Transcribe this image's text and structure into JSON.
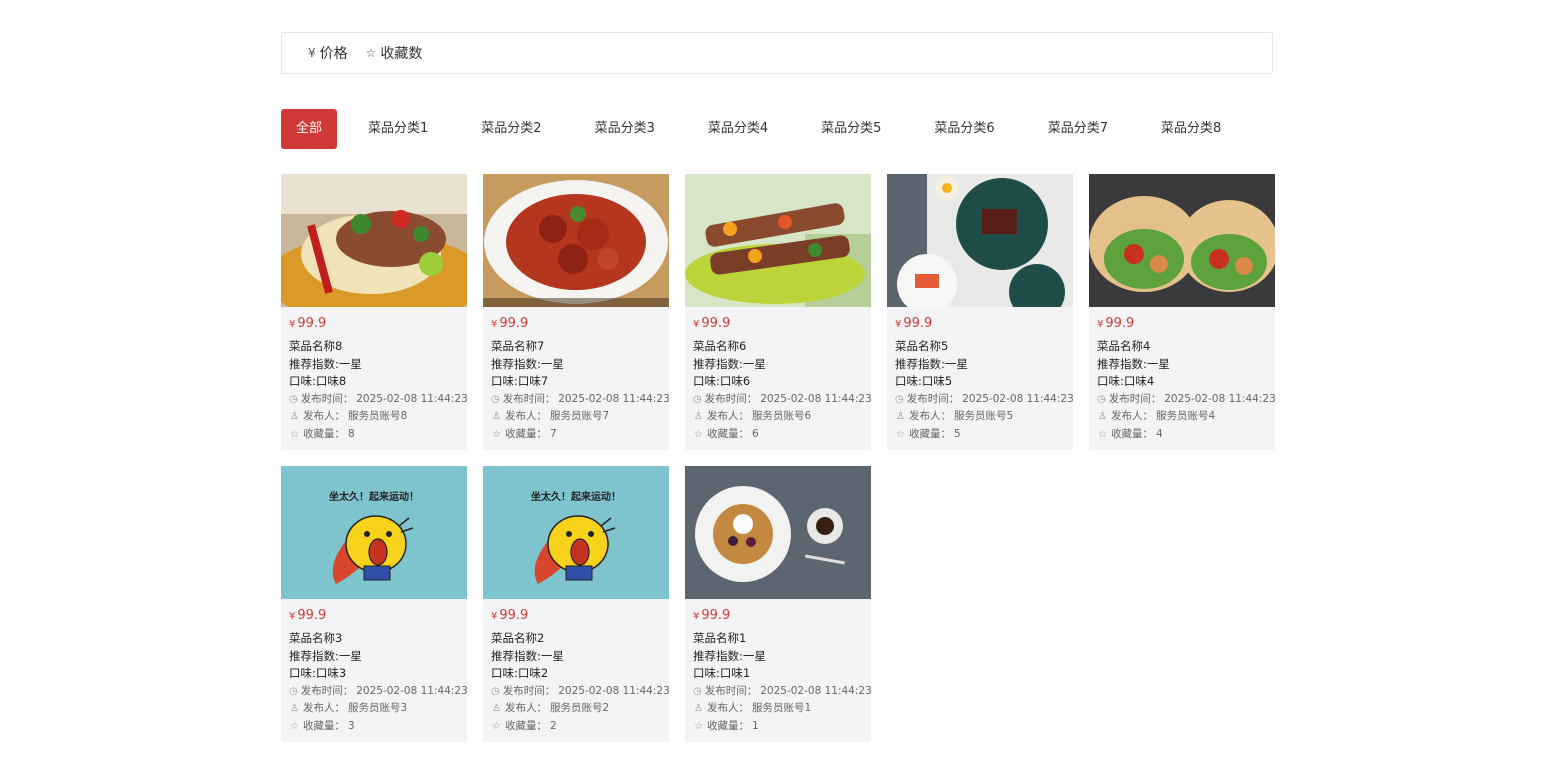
{
  "sort": {
    "price_icon": "yen-icon",
    "price_label": "价格",
    "fav_icon": "star-icon",
    "fav_label": "收藏数"
  },
  "categories": [
    "全部",
    "菜品分类1",
    "菜品分类2",
    "菜品分类3",
    "菜品分类4",
    "菜品分类5",
    "菜品分类6",
    "菜品分类7",
    "菜品分类8"
  ],
  "labels": {
    "currency": "¥",
    "time_prefix": "发布时间：",
    "publisher_prefix": "发布人：",
    "fav_prefix": "收藏量："
  },
  "items": [
    {
      "image": "tacos",
      "price": "99.9",
      "name": "菜品名称8",
      "recommend": "推荐指数:一星",
      "taste": "口味:口味8",
      "time": "2025-02-08 11:44:23",
      "publisher": "服务员账号8",
      "favorites": "8"
    },
    {
      "image": "crayfish",
      "price": "99.9",
      "name": "菜品名称7",
      "recommend": "推荐指数:一星",
      "taste": "口味:口味7",
      "time": "2025-02-08 11:44:23",
      "publisher": "服务员账号7",
      "favorites": "7"
    },
    {
      "image": "skewers",
      "price": "99.9",
      "name": "菜品名称6",
      "recommend": "推荐指数:一星",
      "taste": "口味:口味6",
      "time": "2025-02-08 11:44:23",
      "publisher": "服务员账号6",
      "favorites": "6"
    },
    {
      "image": "plates",
      "price": "99.9",
      "name": "菜品名称5",
      "recommend": "推荐指数:一星",
      "taste": "口味:口味5",
      "time": "2025-02-08 11:44:23",
      "publisher": "服务员账号5",
      "favorites": "5"
    },
    {
      "image": "wraps",
      "price": "99.9",
      "name": "菜品名称4",
      "recommend": "推荐指数:一星",
      "taste": "口味:口味4",
      "time": "2025-02-08 11:44:23",
      "publisher": "服务员账号4",
      "favorites": "4"
    },
    {
      "image": "chick",
      "price": "99.9",
      "name": "菜品名称3",
      "recommend": "推荐指数:一星",
      "taste": "口味:口味3",
      "time": "2025-02-08 11:44:23",
      "publisher": "服务员账号3",
      "favorites": "3"
    },
    {
      "image": "chick",
      "price": "99.9",
      "name": "菜品名称2",
      "recommend": "推荐指数:一星",
      "taste": "口味:口味2",
      "time": "2025-02-08 11:44:23",
      "publisher": "服务员账号2",
      "favorites": "2"
    },
    {
      "image": "waffle",
      "price": "99.9",
      "name": "菜品名称1",
      "recommend": "推荐指数:一星",
      "taste": "口味:口味1",
      "time": "2025-02-08 11:44:23",
      "publisher": "服务员账号1",
      "favorites": "1"
    }
  ],
  "chick_caption": "坐太久！起来运动！",
  "colors": {
    "accent": "#d03a36",
    "card_bg": "#f4f4f6",
    "chick_bg": "#7ec4cf"
  }
}
